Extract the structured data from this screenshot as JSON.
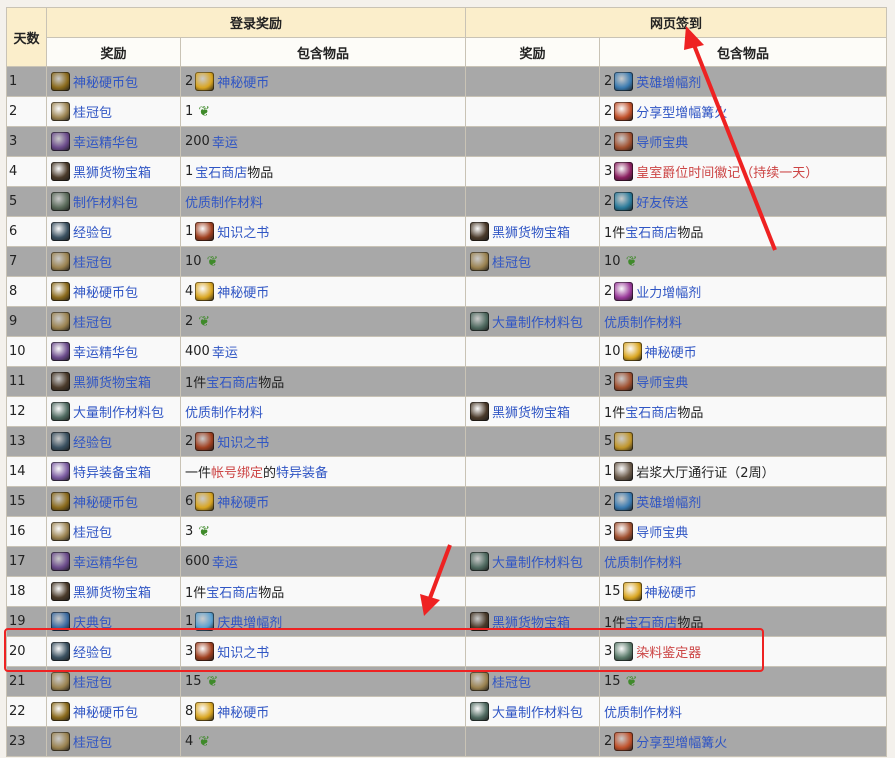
{
  "table": {
    "day_header": "天数",
    "login_header": "登录奖励",
    "web_header": "网页签到",
    "reward_header": "奖励",
    "contents_header": "包含物品",
    "rows": [
      {
        "day": "1",
        "l_icon": "coin-bag-icon",
        "l_label": "神秘硬币包",
        "l_contents": [
          {
            "t": "num",
            "v": "2"
          },
          {
            "t": "icon",
            "name": "coin-icon"
          },
          {
            "t": "link",
            "v": "神秘硬币"
          }
        ],
        "w_icon": "",
        "w_label": "",
        "w_contents": [
          {
            "t": "num",
            "v": "2"
          },
          {
            "t": "icon",
            "name": "hero-booster-icon"
          },
          {
            "t": "link",
            "v": "英雄增幅剂"
          }
        ]
      },
      {
        "day": "2",
        "l_icon": "laurel-bag-icon",
        "l_label": "桂冠包",
        "l_contents": [
          {
            "t": "num",
            "v": "1"
          },
          {
            "t": "icon",
            "name": "laurel-icon"
          }
        ],
        "w_icon": "",
        "w_label": "",
        "w_contents": [
          {
            "t": "num",
            "v": "2"
          },
          {
            "t": "icon",
            "name": "shared-booster-icon"
          },
          {
            "t": "link",
            "v": "分享型增幅篝火"
          }
        ]
      },
      {
        "day": "3",
        "l_icon": "luck-essence-icon",
        "l_label": "幸运精华包",
        "l_contents": [
          {
            "t": "num",
            "v": "200"
          },
          {
            "t": "link",
            "v": "幸运"
          }
        ],
        "w_icon": "",
        "w_label": "",
        "w_contents": [
          {
            "t": "num",
            "v": "2"
          },
          {
            "t": "icon",
            "name": "mentor-tome-icon"
          },
          {
            "t": "link",
            "v": "导师宝典"
          }
        ]
      },
      {
        "day": "4",
        "l_icon": "black-lion-chest-icon",
        "l_label": "黑狮货物宝箱",
        "l_contents": [
          {
            "t": "num",
            "v": "1"
          },
          {
            "t": "link",
            "v": "宝石商店"
          },
          {
            "t": "text",
            "v": "物品"
          }
        ],
        "w_icon": "",
        "w_label": "",
        "w_contents": [
          {
            "t": "num",
            "v": "3"
          },
          {
            "t": "icon",
            "name": "royal-terrace-icon"
          },
          {
            "t": "red",
            "v": "皇室爵位时间徽记（持续一天）"
          }
        ]
      },
      {
        "day": "5",
        "l_icon": "crafting-bag-icon",
        "l_label": "制作材料包",
        "l_contents": [
          {
            "t": "link",
            "v": "优质制作材料"
          }
        ],
        "w_icon": "",
        "w_label": "",
        "w_contents": [
          {
            "t": "num",
            "v": "2"
          },
          {
            "t": "icon",
            "name": "friend-teleport-icon"
          },
          {
            "t": "link",
            "v": "好友传送"
          }
        ]
      },
      {
        "day": "6",
        "l_icon": "xp-bag-icon",
        "l_label": "经验包",
        "l_contents": [
          {
            "t": "num",
            "v": "1"
          },
          {
            "t": "icon",
            "name": "knowledge-tome-icon"
          },
          {
            "t": "link",
            "v": "知识之书"
          }
        ],
        "w_icon": "black-lion-chest-icon",
        "w_label": "黑狮货物宝箱",
        "w_contents": [
          {
            "t": "text",
            "v": "1件"
          },
          {
            "t": "link",
            "v": "宝石商店"
          },
          {
            "t": "text",
            "v": "物品"
          }
        ]
      },
      {
        "day": "7",
        "l_icon": "laurel-bag-icon",
        "l_label": "桂冠包",
        "l_contents": [
          {
            "t": "num",
            "v": "10"
          },
          {
            "t": "icon",
            "name": "laurel-icon"
          }
        ],
        "w_icon": "laurel-bag-icon",
        "w_label": "桂冠包",
        "w_contents": [
          {
            "t": "num",
            "v": "10"
          },
          {
            "t": "icon",
            "name": "laurel-icon"
          }
        ]
      },
      {
        "day": "8",
        "l_icon": "coin-bag-icon",
        "l_label": "神秘硬币包",
        "l_contents": [
          {
            "t": "num",
            "v": "4"
          },
          {
            "t": "icon",
            "name": "coin-icon"
          },
          {
            "t": "link",
            "v": "神秘硬币"
          }
        ],
        "w_icon": "",
        "w_label": "",
        "w_contents": [
          {
            "t": "num",
            "v": "2"
          },
          {
            "t": "icon",
            "name": "karma-booster-icon"
          },
          {
            "t": "link",
            "v": "业力增幅剂"
          }
        ]
      },
      {
        "day": "9",
        "l_icon": "laurel-bag-icon",
        "l_label": "桂冠包",
        "l_contents": [
          {
            "t": "num",
            "v": "2"
          },
          {
            "t": "icon",
            "name": "laurel-icon"
          }
        ],
        "w_icon": "large-crafting-bag-icon",
        "w_label": "大量制作材料包",
        "w_contents": [
          {
            "t": "link",
            "v": "优质制作材料"
          }
        ]
      },
      {
        "day": "10",
        "l_icon": "luck-essence-icon",
        "l_label": "幸运精华包",
        "l_contents": [
          {
            "t": "num",
            "v": "400"
          },
          {
            "t": "link",
            "v": "幸运"
          }
        ],
        "w_icon": "",
        "w_label": "",
        "w_contents": [
          {
            "t": "num",
            "v": "10"
          },
          {
            "t": "icon",
            "name": "coin-icon"
          },
          {
            "t": "link",
            "v": "神秘硬币"
          }
        ]
      },
      {
        "day": "11",
        "l_icon": "black-lion-chest-icon",
        "l_label": "黑狮货物宝箱",
        "l_contents": [
          {
            "t": "text",
            "v": "1件"
          },
          {
            "t": "link",
            "v": "宝石商店"
          },
          {
            "t": "text",
            "v": "物品"
          }
        ],
        "w_icon": "",
        "w_label": "",
        "w_contents": [
          {
            "t": "num",
            "v": "3"
          },
          {
            "t": "icon",
            "name": "mentor-tome-icon"
          },
          {
            "t": "link",
            "v": "导师宝典"
          }
        ]
      },
      {
        "day": "12",
        "l_icon": "large-crafting-bag-icon",
        "l_label": "大量制作材料包",
        "l_contents": [
          {
            "t": "link",
            "v": "优质制作材料"
          }
        ],
        "w_icon": "black-lion-chest-icon",
        "w_label": "黑狮货物宝箱",
        "w_contents": [
          {
            "t": "text",
            "v": "1件"
          },
          {
            "t": "link",
            "v": "宝石商店"
          },
          {
            "t": "text",
            "v": "物品"
          }
        ]
      },
      {
        "day": "13",
        "l_icon": "xp-bag-icon",
        "l_label": "经验包",
        "l_contents": [
          {
            "t": "num",
            "v": "2"
          },
          {
            "t": "icon",
            "name": "knowledge-tome-icon"
          },
          {
            "t": "link",
            "v": "知识之书"
          }
        ],
        "w_icon": "",
        "w_label": "",
        "w_contents": [
          {
            "t": "num",
            "v": "5"
          },
          {
            "t": "icon",
            "name": "gold-ingot-icon"
          }
        ]
      },
      {
        "day": "14",
        "l_icon": "exotic-chest-icon",
        "l_label": "特异装备宝箱",
        "l_contents": [
          {
            "t": "text",
            "v": "一件"
          },
          {
            "t": "red",
            "v": "帐号绑定"
          },
          {
            "t": "text",
            "v": "的"
          },
          {
            "t": "link",
            "v": "特异装备"
          }
        ],
        "w_icon": "",
        "w_label": "",
        "w_contents": [
          {
            "t": "num",
            "v": "1"
          },
          {
            "t": "icon",
            "name": "lava-pass-icon"
          },
          {
            "t": "text",
            "v": "岩浆大厅通行证（2周）"
          }
        ]
      },
      {
        "day": "15",
        "l_icon": "coin-bag-icon",
        "l_label": "神秘硬币包",
        "l_contents": [
          {
            "t": "num",
            "v": "6"
          },
          {
            "t": "icon",
            "name": "coin-icon"
          },
          {
            "t": "link",
            "v": "神秘硬币"
          }
        ],
        "w_icon": "",
        "w_label": "",
        "w_contents": [
          {
            "t": "num",
            "v": "2"
          },
          {
            "t": "icon",
            "name": "hero-booster-icon"
          },
          {
            "t": "link",
            "v": "英雄增幅剂"
          }
        ]
      },
      {
        "day": "16",
        "l_icon": "laurel-bag-icon",
        "l_label": "桂冠包",
        "l_contents": [
          {
            "t": "num",
            "v": "3"
          },
          {
            "t": "icon",
            "name": "laurel-icon"
          }
        ],
        "w_icon": "",
        "w_label": "",
        "w_contents": [
          {
            "t": "num",
            "v": "3"
          },
          {
            "t": "icon",
            "name": "mentor-tome-icon"
          },
          {
            "t": "link",
            "v": "导师宝典"
          }
        ]
      },
      {
        "day": "17",
        "l_icon": "luck-essence-icon",
        "l_label": "幸运精华包",
        "l_contents": [
          {
            "t": "num",
            "v": "600"
          },
          {
            "t": "link",
            "v": "幸运"
          }
        ],
        "w_icon": "large-crafting-bag-icon",
        "w_label": "大量制作材料包",
        "w_contents": [
          {
            "t": "link",
            "v": "优质制作材料"
          }
        ]
      },
      {
        "day": "18",
        "l_icon": "black-lion-chest-icon",
        "l_label": "黑狮货物宝箱",
        "l_contents": [
          {
            "t": "text",
            "v": "1件"
          },
          {
            "t": "link",
            "v": "宝石商店"
          },
          {
            "t": "text",
            "v": "物品"
          }
        ],
        "w_icon": "",
        "w_label": "",
        "w_contents": [
          {
            "t": "num",
            "v": "15"
          },
          {
            "t": "icon",
            "name": "coin-icon"
          },
          {
            "t": "link",
            "v": "神秘硬币"
          }
        ]
      },
      {
        "day": "19",
        "l_icon": "celebration-bag-icon",
        "l_label": "庆典包",
        "l_contents": [
          {
            "t": "num",
            "v": "1"
          },
          {
            "t": "icon",
            "name": "celebration-booster-icon"
          },
          {
            "t": "link",
            "v": "庆典增幅剂"
          }
        ],
        "w_icon": "black-lion-chest-icon",
        "w_label": "黑狮货物宝箱",
        "w_contents": [
          {
            "t": "text",
            "v": "1件"
          },
          {
            "t": "link",
            "v": "宝石商店"
          },
          {
            "t": "text",
            "v": "物品"
          }
        ]
      },
      {
        "day": "20",
        "l_icon": "xp-bag-icon",
        "l_label": "经验包",
        "l_contents": [
          {
            "t": "num",
            "v": "3"
          },
          {
            "t": "icon",
            "name": "knowledge-tome-icon"
          },
          {
            "t": "link",
            "v": "知识之书"
          }
        ],
        "w_icon": "",
        "w_label": "",
        "w_contents": [
          {
            "t": "num",
            "v": "3"
          },
          {
            "t": "icon",
            "name": "dye-kit-icon"
          },
          {
            "t": "red",
            "v": "染料鉴定器"
          }
        ]
      },
      {
        "day": "21",
        "l_icon": "laurel-bag-icon",
        "l_label": "桂冠包",
        "l_contents": [
          {
            "t": "num",
            "v": "15"
          },
          {
            "t": "icon",
            "name": "laurel-icon"
          }
        ],
        "w_icon": "laurel-bag-icon",
        "w_label": "桂冠包",
        "w_contents": [
          {
            "t": "num",
            "v": "15"
          },
          {
            "t": "icon",
            "name": "laurel-icon"
          }
        ]
      },
      {
        "day": "22",
        "l_icon": "coin-bag-icon",
        "l_label": "神秘硬币包",
        "l_contents": [
          {
            "t": "num",
            "v": "8"
          },
          {
            "t": "icon",
            "name": "coin-icon"
          },
          {
            "t": "link",
            "v": "神秘硬币"
          }
        ],
        "w_icon": "large-crafting-bag-icon",
        "w_label": "大量制作材料包",
        "w_contents": [
          {
            "t": "link",
            "v": "优质制作材料"
          }
        ]
      },
      {
        "day": "23",
        "l_icon": "laurel-bag-icon",
        "l_label": "桂冠包",
        "l_contents": [
          {
            "t": "num",
            "v": "4"
          },
          {
            "t": "icon",
            "name": "laurel-icon"
          }
        ],
        "w_icon": "",
        "w_label": "",
        "w_contents": [
          {
            "t": "num",
            "v": "2"
          },
          {
            "t": "icon",
            "name": "shared-booster-icon"
          },
          {
            "t": "link",
            "v": "分享型增幅篝火"
          }
        ]
      }
    ]
  },
  "icon_colors": {
    "coin-bag-icon": "#8a6a1c",
    "coin-icon": "#d9a520",
    "laurel-bag-icon": "#9a8250",
    "luck-essence-icon": "#6a4a8a",
    "black-lion-chest-icon": "#4a3a2a",
    "crafting-bag-icon": "#5a6a5a",
    "large-crafting-bag-icon": "#4f6a60",
    "xp-bag-icon": "#3a5060",
    "exotic-chest-icon": "#7a5aa0",
    "celebration-bag-icon": "#3a6aa0",
    "knowledge-tome-icon": "#a04020",
    "hero-booster-icon": "#3a7ab0",
    "shared-booster-icon": "#c0502a",
    "mentor-tome-icon": "#a05030",
    "royal-terrace-icon": "#8a2060",
    "friend-teleport-icon": "#2a7a9a",
    "karma-booster-icon": "#9a3a9a",
    "gold-ingot-icon": "#c0952a",
    "lava-pass-icon": "#6a5a4a",
    "celebration-booster-icon": "#5aa0d0",
    "dye-kit-icon": "#5a7a6a"
  },
  "annotation_colors": {
    "highlight": "#ee2222"
  }
}
